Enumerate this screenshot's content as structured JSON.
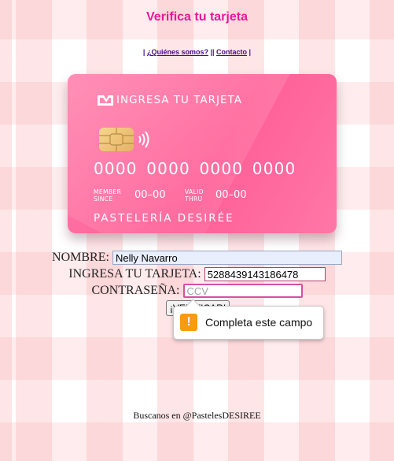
{
  "page": {
    "title": "Verifica tu tarjeta",
    "nav": {
      "open": "| ",
      "link1": "¿Quiénes somos?",
      "sep": " || ",
      "link2": "Contacto",
      "close": " |"
    }
  },
  "card": {
    "brand": "INGRESA TU TARJETA",
    "number": "0000 0000 0000 0000",
    "member_label": "MEMBER SINCE",
    "member_value": "00–00",
    "valid_label": "VALID THRU",
    "valid_value": "00–00",
    "holder": "PASTELERÍA DESIRÉE",
    "icons": [
      "card-logo-icon",
      "chip-icon",
      "contactless-icon"
    ],
    "colors": {
      "base": "#ff6699",
      "text": "#ffffff"
    }
  },
  "form": {
    "name_label": "NOMBRE:",
    "name_value": "Nelly Navarro",
    "card_label": "INGRESA TU TARJETA:",
    "card_value": "5288439143186478",
    "password_label": "CONTRASEÑA:",
    "password_placeholder": "CCV",
    "submit_label": "¡VERIFICAR!"
  },
  "validation": {
    "message": "Completa este campo",
    "icon": "warning-icon",
    "icon_glyph": "!"
  },
  "footer": {
    "text": "Buscanos en @PastelesDESIREE"
  },
  "colors": {
    "accent": "#e8189a",
    "nav": "#4a0a8a",
    "warning": "#f79b10"
  }
}
